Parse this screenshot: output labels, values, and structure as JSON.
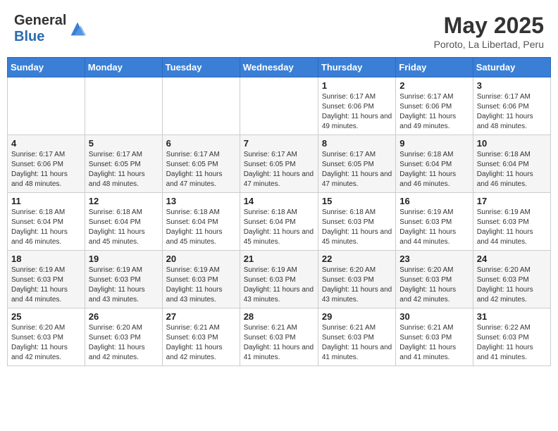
{
  "header": {
    "logo_general": "General",
    "logo_blue": "Blue",
    "main_title": "May 2025",
    "sub_title": "Poroto, La Libertad, Peru"
  },
  "calendar": {
    "days_of_week": [
      "Sunday",
      "Monday",
      "Tuesday",
      "Wednesday",
      "Thursday",
      "Friday",
      "Saturday"
    ],
    "weeks": [
      [
        {
          "day": "",
          "info": ""
        },
        {
          "day": "",
          "info": ""
        },
        {
          "day": "",
          "info": ""
        },
        {
          "day": "",
          "info": ""
        },
        {
          "day": "1",
          "info": "Sunrise: 6:17 AM\nSunset: 6:06 PM\nDaylight: 11 hours\nand 49 minutes."
        },
        {
          "day": "2",
          "info": "Sunrise: 6:17 AM\nSunset: 6:06 PM\nDaylight: 11 hours\nand 49 minutes."
        },
        {
          "day": "3",
          "info": "Sunrise: 6:17 AM\nSunset: 6:06 PM\nDaylight: 11 hours\nand 48 minutes."
        }
      ],
      [
        {
          "day": "4",
          "info": "Sunrise: 6:17 AM\nSunset: 6:06 PM\nDaylight: 11 hours\nand 48 minutes."
        },
        {
          "day": "5",
          "info": "Sunrise: 6:17 AM\nSunset: 6:05 PM\nDaylight: 11 hours\nand 48 minutes."
        },
        {
          "day": "6",
          "info": "Sunrise: 6:17 AM\nSunset: 6:05 PM\nDaylight: 11 hours\nand 47 minutes."
        },
        {
          "day": "7",
          "info": "Sunrise: 6:17 AM\nSunset: 6:05 PM\nDaylight: 11 hours\nand 47 minutes."
        },
        {
          "day": "8",
          "info": "Sunrise: 6:17 AM\nSunset: 6:05 PM\nDaylight: 11 hours\nand 47 minutes."
        },
        {
          "day": "9",
          "info": "Sunrise: 6:18 AM\nSunset: 6:04 PM\nDaylight: 11 hours\nand 46 minutes."
        },
        {
          "day": "10",
          "info": "Sunrise: 6:18 AM\nSunset: 6:04 PM\nDaylight: 11 hours\nand 46 minutes."
        }
      ],
      [
        {
          "day": "11",
          "info": "Sunrise: 6:18 AM\nSunset: 6:04 PM\nDaylight: 11 hours\nand 46 minutes."
        },
        {
          "day": "12",
          "info": "Sunrise: 6:18 AM\nSunset: 6:04 PM\nDaylight: 11 hours\nand 45 minutes."
        },
        {
          "day": "13",
          "info": "Sunrise: 6:18 AM\nSunset: 6:04 PM\nDaylight: 11 hours\nand 45 minutes."
        },
        {
          "day": "14",
          "info": "Sunrise: 6:18 AM\nSunset: 6:04 PM\nDaylight: 11 hours\nand 45 minutes."
        },
        {
          "day": "15",
          "info": "Sunrise: 6:18 AM\nSunset: 6:03 PM\nDaylight: 11 hours\nand 45 minutes."
        },
        {
          "day": "16",
          "info": "Sunrise: 6:19 AM\nSunset: 6:03 PM\nDaylight: 11 hours\nand 44 minutes."
        },
        {
          "day": "17",
          "info": "Sunrise: 6:19 AM\nSunset: 6:03 PM\nDaylight: 11 hours\nand 44 minutes."
        }
      ],
      [
        {
          "day": "18",
          "info": "Sunrise: 6:19 AM\nSunset: 6:03 PM\nDaylight: 11 hours\nand 44 minutes."
        },
        {
          "day": "19",
          "info": "Sunrise: 6:19 AM\nSunset: 6:03 PM\nDaylight: 11 hours\nand 43 minutes."
        },
        {
          "day": "20",
          "info": "Sunrise: 6:19 AM\nSunset: 6:03 PM\nDaylight: 11 hours\nand 43 minutes."
        },
        {
          "day": "21",
          "info": "Sunrise: 6:19 AM\nSunset: 6:03 PM\nDaylight: 11 hours\nand 43 minutes."
        },
        {
          "day": "22",
          "info": "Sunrise: 6:20 AM\nSunset: 6:03 PM\nDaylight: 11 hours\nand 43 minutes."
        },
        {
          "day": "23",
          "info": "Sunrise: 6:20 AM\nSunset: 6:03 PM\nDaylight: 11 hours\nand 42 minutes."
        },
        {
          "day": "24",
          "info": "Sunrise: 6:20 AM\nSunset: 6:03 PM\nDaylight: 11 hours\nand 42 minutes."
        }
      ],
      [
        {
          "day": "25",
          "info": "Sunrise: 6:20 AM\nSunset: 6:03 PM\nDaylight: 11 hours\nand 42 minutes."
        },
        {
          "day": "26",
          "info": "Sunrise: 6:20 AM\nSunset: 6:03 PM\nDaylight: 11 hours\nand 42 minutes."
        },
        {
          "day": "27",
          "info": "Sunrise: 6:21 AM\nSunset: 6:03 PM\nDaylight: 11 hours\nand 42 minutes."
        },
        {
          "day": "28",
          "info": "Sunrise: 6:21 AM\nSunset: 6:03 PM\nDaylight: 11 hours\nand 41 minutes."
        },
        {
          "day": "29",
          "info": "Sunrise: 6:21 AM\nSunset: 6:03 PM\nDaylight: 11 hours\nand 41 minutes."
        },
        {
          "day": "30",
          "info": "Sunrise: 6:21 AM\nSunset: 6:03 PM\nDaylight: 11 hours\nand 41 minutes."
        },
        {
          "day": "31",
          "info": "Sunrise: 6:22 AM\nSunset: 6:03 PM\nDaylight: 11 hours\nand 41 minutes."
        }
      ]
    ]
  }
}
